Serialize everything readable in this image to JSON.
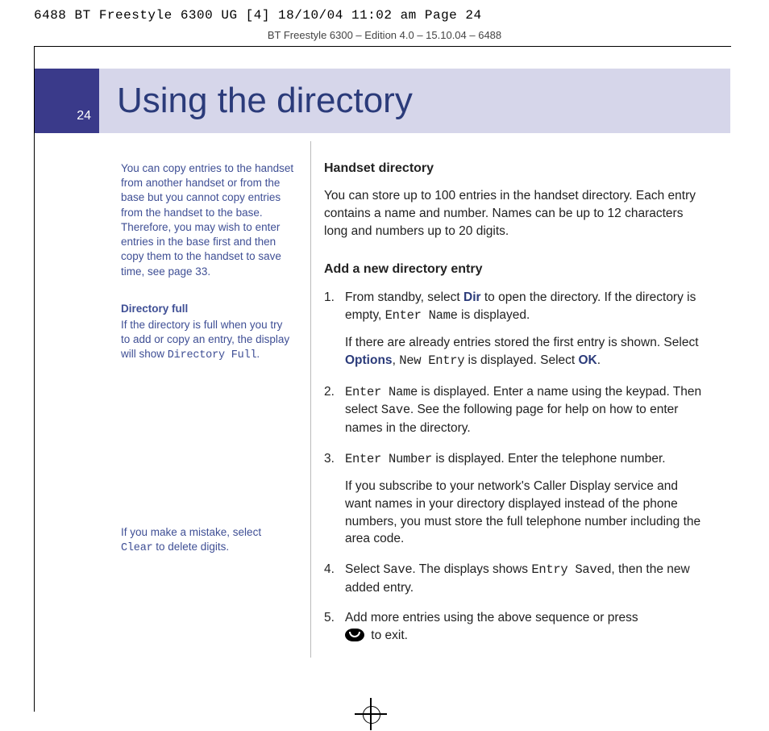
{
  "prepress": {
    "job_line": "6488 BT Freestyle 6300 UG [4]  18/10/04  11:02 am  Page 24",
    "edition_line": "BT Freestyle 6300 – Edition 4.0 – 15.10.04 – 6488"
  },
  "header": {
    "page_number": "24",
    "title": "Using the directory"
  },
  "sidebar": {
    "copy_note": "You can copy entries to the handset from another handset or from the base but you cannot copy entries from the handset to the base. Therefore, you may wish to enter entries in the base first and then copy them to the handset to save time, see page 33.",
    "dir_full_head": "Directory full",
    "dir_full_body_pre": "If the directory is full when you try to add or copy an entry, the display will show ",
    "dir_full_lcd": "Directory Full",
    "dir_full_body_post": ".",
    "mistake_pre": "If you make a mistake, select ",
    "mistake_lcd": "Clear",
    "mistake_post": " to delete digits."
  },
  "main": {
    "h_handset": "Handset directory",
    "p_handset": "You can store up to 100 entries in the handset directory. Each entry contains a name and number. Names can be up to 12 characters long and numbers up to 20 digits.",
    "h_add": "Add a new directory entry",
    "step1_a": "From standby, select ",
    "step1_dir": "Dir",
    "step1_b": " to open the directory. If the directory is empty, ",
    "step1_lcd_enter_name": "Enter Name",
    "step1_c": " is displayed.",
    "step1_sub_a": "If there are already entries stored the first entry is shown. Select ",
    "step1_options": "Options",
    "step1_sub_b": ", ",
    "step1_lcd_new_entry": "New Entry",
    "step1_sub_c": " is displayed. Select ",
    "step1_ok": "OK",
    "step1_sub_d": ".",
    "step2_lcd": "Enter Name",
    "step2_a": " is displayed. Enter a name using the keypad. Then select ",
    "step2_save": "Save",
    "step2_b": ". See the following page for help on how to enter names in the directory.",
    "step3_lcd": "Enter Number",
    "step3_a": " is displayed. Enter the telephone number.",
    "step3_sub": "If you subscribe to your network's Caller Display service and want names in your directory displayed instead of the phone numbers, you must store the full telephone number including the area code.",
    "step4_a": "Select ",
    "step4_save": "Save",
    "step4_b": ". The displays shows ",
    "step4_lcd": "Entry Saved",
    "step4_c": ", then the new added entry.",
    "step5_a": "Add more entries using the above sequence or press ",
    "step5_b": " to exit."
  }
}
